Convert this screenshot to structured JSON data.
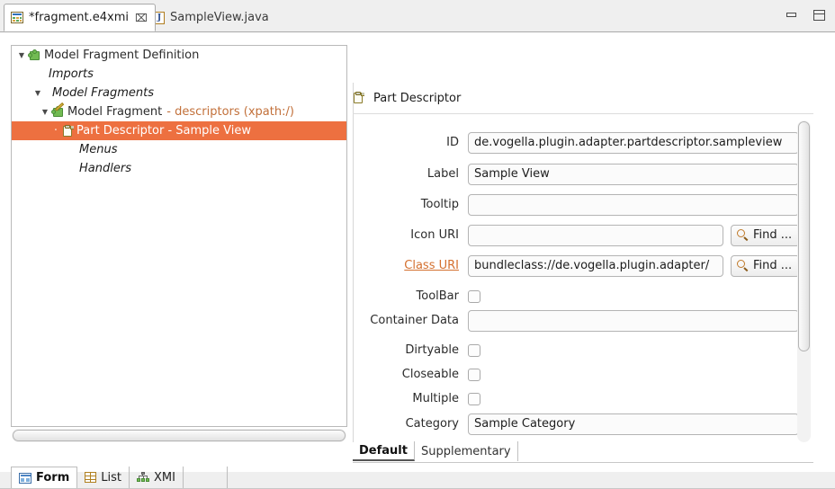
{
  "window": {
    "minimize_label": "Minimize",
    "maximize_label": "Maximize"
  },
  "editor_tabs": [
    {
      "label": "*fragment.e4xmi",
      "icon": "e4xmi-model-icon",
      "active": true,
      "close_glyph": "⌧"
    },
    {
      "label": "SampleView.java",
      "icon": "java-file-icon",
      "active": false
    }
  ],
  "tree": {
    "rows": [
      {
        "label": "Model Fragment Definition",
        "suffix": "",
        "indent": 4,
        "twisty": "open",
        "icon": "puzzle",
        "italic": false,
        "selected": false
      },
      {
        "label": "Imports",
        "suffix": "",
        "indent": 38,
        "twisty": "none",
        "icon": "none",
        "italic": true,
        "selected": false
      },
      {
        "label": "Model Fragments",
        "suffix": "",
        "indent": 22,
        "twisty": "open",
        "icon": "none",
        "italic": true,
        "selected": false
      },
      {
        "label": "Model Fragment",
        "suffix": "- descriptors (xpath:/)",
        "indent": 30,
        "twisty": "open",
        "icon": "puzzle-pencil",
        "italic": false,
        "selected": false
      },
      {
        "label": "Part Descriptor - Sample View",
        "suffix": "",
        "indent": 42,
        "twisty": "leafdash",
        "icon": "clipboard",
        "italic": false,
        "selected": true
      },
      {
        "label": "Menus",
        "suffix": "",
        "indent": 72,
        "twisty": "none",
        "icon": "none",
        "italic": true,
        "selected": false
      },
      {
        "label": "Handlers",
        "suffix": "",
        "indent": 72,
        "twisty": "none",
        "icon": "none",
        "italic": true,
        "selected": false
      }
    ]
  },
  "form": {
    "header_title": "Part Descriptor",
    "header_icon": "clipboard-icon",
    "fields": [
      {
        "label": "ID",
        "type": "text",
        "value": "de.vogella.plugin.adapter.partdescriptor.sampleview",
        "placeholder": "",
        "width": "wide",
        "find": false,
        "link": false
      },
      {
        "label": "Label",
        "type": "text",
        "value": "Sample View",
        "placeholder": "",
        "width": "wide",
        "find": false,
        "link": false
      },
      {
        "label": "Tooltip",
        "type": "text",
        "value": "",
        "placeholder": "",
        "width": "wide",
        "find": false,
        "link": false
      },
      {
        "label": "Icon URI",
        "type": "text",
        "value": "",
        "placeholder": "",
        "width": "narrow",
        "find": true,
        "link": false
      },
      {
        "label": "Class URI",
        "type": "text",
        "value": "bundleclass://de.vogella.plugin.adapter/",
        "placeholder": "",
        "width": "narrow",
        "find": true,
        "link": true
      },
      {
        "label": "ToolBar",
        "type": "checkbox",
        "checked": false,
        "width": "",
        "find": false,
        "link": false
      },
      {
        "label": "Container Data",
        "type": "text",
        "value": "",
        "placeholder": "",
        "width": "wide",
        "find": false,
        "link": false
      },
      {
        "label": "Dirtyable",
        "type": "checkbox",
        "checked": false,
        "width": "",
        "find": false,
        "link": false
      },
      {
        "label": "Closeable",
        "type": "checkbox",
        "checked": false,
        "width": "",
        "find": false,
        "link": false
      },
      {
        "label": "Multiple",
        "type": "checkbox",
        "checked": false,
        "width": "",
        "find": false,
        "link": false
      },
      {
        "label": "Category",
        "type": "text",
        "value": "Sample Category",
        "placeholder": "",
        "width": "wide",
        "find": false,
        "link": false
      }
    ],
    "find_button_label": "Find ..."
  },
  "sub_tabs": [
    {
      "label": "Default",
      "active": true
    },
    {
      "label": "Supplementary",
      "active": false
    }
  ],
  "bottom_tabs": [
    {
      "label": "Form",
      "icon": "form-icon",
      "active": true
    },
    {
      "label": "List",
      "icon": "table-icon",
      "active": false
    },
    {
      "label": "XMI",
      "icon": "xmi-icon",
      "active": false
    }
  ],
  "colors": {
    "selection": "#ed7040",
    "link": "#d4702f",
    "tree_suffix": "#c2703a"
  }
}
